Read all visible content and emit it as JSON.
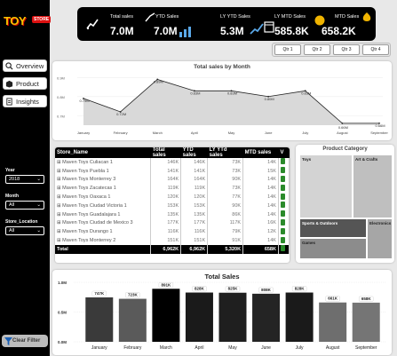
{
  "sidebar": {
    "logo_text": "TOY",
    "logo_badge": "STORE",
    "nav": [
      {
        "label": "Overview"
      },
      {
        "label": "Product"
      },
      {
        "label": "Insights"
      }
    ],
    "slicers": [
      {
        "label": "Year",
        "value": "2018"
      },
      {
        "label": "Month",
        "value": "All"
      },
      {
        "label": "Store_Location",
        "value": "All"
      }
    ],
    "clear_label": "Clear Filter"
  },
  "kpis": [
    {
      "title": "Total sales",
      "value": "7.0M"
    },
    {
      "title": "YTD Sales",
      "value": "7.0M"
    },
    {
      "title": "LY YTD Sales",
      "value": "5.3M"
    },
    {
      "title": "LY MTD Sales",
      "value": "585.8K"
    },
    {
      "title": "MTD Sales",
      "value": "658.2K"
    }
  ],
  "quarters": [
    "Qtr 1",
    "Qtr 2",
    "Qtr 3",
    "Qtr 4"
  ],
  "line_chart": {
    "chart_data": {
      "type": "line",
      "title": "Total sales by Month",
      "categories": [
        "January",
        "February",
        "March",
        "April",
        "May",
        "June",
        "July",
        "August",
        "September"
      ],
      "values": [
        0.79,
        0.72,
        0.89,
        0.83,
        0.83,
        0.8,
        0.83,
        0.66,
        0.66
      ],
      "labels": [
        "0.79M",
        "0.72M",
        "0.89M",
        "0.83M",
        "0.83M",
        "0.80M",
        "0.83M",
        "0.66M",
        "0.66M"
      ],
      "yticks": [
        "0.9M",
        "0.8M",
        "0.7M"
      ],
      "ylim": [
        0.65,
        0.92
      ]
    }
  },
  "table": {
    "columns": [
      "Store_Name",
      "Total sales",
      "YTD sales",
      "LY YTd sales",
      "MTD sales",
      "V"
    ],
    "rows": [
      {
        "name": "Maven Toys Culiacan 1",
        "ts": "146K",
        "ytd": "146K",
        "ly": "73K",
        "mtd": "14K"
      },
      {
        "name": "Maven Toys Puebla 1",
        "ts": "141K",
        "ytd": "141K",
        "ly": "73K",
        "mtd": "15K"
      },
      {
        "name": "Maven Toys Monterrey 3",
        "ts": "164K",
        "ytd": "164K",
        "ly": "90K",
        "mtd": "14K"
      },
      {
        "name": "Maven Toys Zacatecas 1",
        "ts": "119K",
        "ytd": "119K",
        "ly": "73K",
        "mtd": "14K"
      },
      {
        "name": "Maven Toys Oaxaca 1",
        "ts": "120K",
        "ytd": "120K",
        "ly": "77K",
        "mtd": "14K"
      },
      {
        "name": "Maven Toys Ciudad Victoria 1",
        "ts": "153K",
        "ytd": "153K",
        "ly": "90K",
        "mtd": "14K"
      },
      {
        "name": "Maven Toys Guadalajara 1",
        "ts": "135K",
        "ytd": "135K",
        "ly": "86K",
        "mtd": "14K"
      },
      {
        "name": "Maven Toys Ciudad de Mexico 3",
        "ts": "177K",
        "ytd": "177K",
        "ly": "117K",
        "mtd": "16K"
      },
      {
        "name": "Maven Toys Durango 1",
        "ts": "116K",
        "ytd": "116K",
        "ly": "79K",
        "mtd": "12K"
      },
      {
        "name": "Maven Toys Monterrey 2",
        "ts": "151K",
        "ytd": "151K",
        "ly": "91K",
        "mtd": "14K"
      }
    ],
    "total": {
      "label": "Total",
      "ts": "6,962K",
      "ytd": "6,962K",
      "ly": "5,320K",
      "mtd": "658K"
    }
  },
  "treemap": {
    "title": "Product Category",
    "cells": [
      {
        "label": "Toys",
        "color": "#d3d3d3"
      },
      {
        "label": "Art & Crafts",
        "color": "#bfbfbf"
      },
      {
        "label": "Sports & Outdoors",
        "color": "#555555"
      },
      {
        "label": "Electronics",
        "color": "#a6a6a6"
      },
      {
        "label": "Games",
        "color": "#8c8c8c"
      }
    ]
  },
  "bar_chart": {
    "chart_data": {
      "type": "bar",
      "title": "Total Sales",
      "categories": [
        "January",
        "February",
        "March",
        "April",
        "May",
        "June",
        "July",
        "August",
        "September"
      ],
      "values": [
        747,
        723,
        891,
        828,
        825,
        808,
        828,
        661,
        658
      ],
      "labels": [
        "747K",
        "723K",
        "891K",
        "828K",
        "825K",
        "808K",
        "828K",
        "661K",
        "658K"
      ],
      "colors": [
        "#3a3a3a",
        "#5a5a5a",
        "#000000",
        "#1a1a1a",
        "#1f1f1f",
        "#242424",
        "#1a1a1a",
        "#6e6e6e",
        "#757575"
      ],
      "yticks": [
        "1.0M",
        "0.5M",
        "0.0M"
      ],
      "ylim": [
        0,
        1000
      ]
    }
  }
}
